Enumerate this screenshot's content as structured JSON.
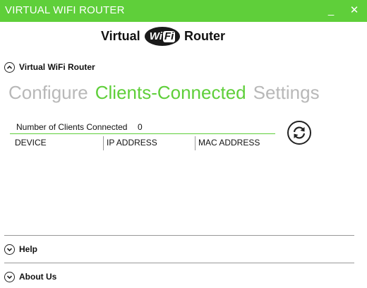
{
  "window": {
    "title": "VIRTUAL WIFI ROUTER",
    "minimize_label": "_",
    "close_label": "✕"
  },
  "logo": {
    "word_left": "Virtual",
    "badge_wi": "Wi",
    "badge_fi": "Fi",
    "word_right": "Router"
  },
  "sections": {
    "main": "Virtual WiFi Router",
    "help": "Help",
    "about": "About Us"
  },
  "tabs": [
    {
      "label": "Configure",
      "active": false
    },
    {
      "label": "Clients-Connected",
      "active": true
    },
    {
      "label": "Settings",
      "active": false
    }
  ],
  "clients": {
    "count_label": "Number of Clients Connected",
    "count_value": "0",
    "columns": [
      "DEVICE",
      "IP ADDRESS",
      "MAC ADDRESS"
    ]
  },
  "icons": {
    "chevron_up": "chevron-up-icon",
    "chevron_down": "chevron-down-icon",
    "refresh": "refresh-icon"
  },
  "colors": {
    "accent": "#5fcf3a",
    "inactive_tab": "#b8b8b8"
  }
}
